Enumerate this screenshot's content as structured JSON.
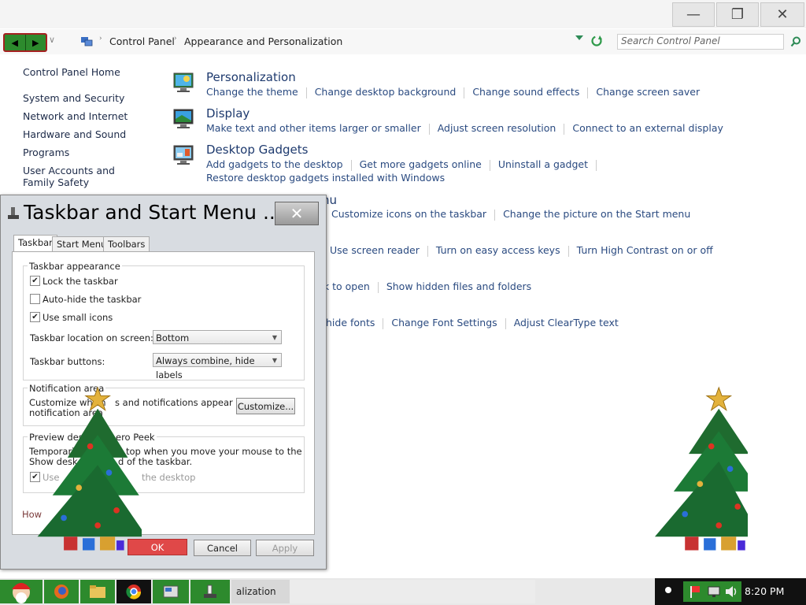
{
  "window": {
    "minimize_glyph": "—",
    "restore_glyph": "❐",
    "close_glyph": "✕"
  },
  "address": {
    "back_glyph": "◀",
    "forward_glyph": "▶",
    "dropdown_glyph": "∨",
    "breadcrumb": [
      "Control Panel",
      "Appearance and Personalization"
    ],
    "search_placeholder": "Search Control Panel"
  },
  "sidebar": {
    "items": [
      {
        "label": "Control Panel Home"
      },
      {
        "label": "System and Security"
      },
      {
        "label": "Network and Internet"
      },
      {
        "label": "Hardware and Sound"
      },
      {
        "label": "Programs"
      },
      {
        "label": "User Accounts and Family Safety"
      }
    ]
  },
  "categories": [
    {
      "title": "Personalization",
      "links": [
        "Change the theme",
        "Change desktop background",
        "Change sound effects",
        "Change screen saver"
      ]
    },
    {
      "title": "Display",
      "links": [
        "Make text and other items larger or smaller",
        "Adjust screen resolution",
        "Connect to an external display"
      ]
    },
    {
      "title": "Desktop Gadgets",
      "links": [
        "Add gadgets to the desktop",
        "Get more gadgets online",
        "Uninstall a gadget"
      ],
      "links2": [
        "Restore desktop gadgets installed with Windows"
      ]
    }
  ],
  "partial": {
    "taskbar_title_tail": "nu",
    "taskbar_links": [
      "Customize icons on the taskbar",
      "Change the picture on the Start menu"
    ],
    "ease_links": [
      "Use screen reader",
      "Turn on easy access keys",
      "Turn High Contrast on or off"
    ],
    "folder_links": [
      "ck to open",
      "Show hidden files and folders"
    ],
    "font_links": [
      "hide fonts",
      "Change Font Settings",
      "Adjust ClearType text"
    ]
  },
  "dialog": {
    "title": "Taskbar and Start Menu ...",
    "close_glyph": "✕",
    "tabs": [
      "Taskbar",
      "Start Menu",
      "Toolbars"
    ],
    "appearance": {
      "group_label": "Taskbar appearance",
      "lock": "Lock the taskbar",
      "autohide": "Auto-hide the taskbar",
      "small_icons": "Use small icons",
      "location_label": "Taskbar location on screen:",
      "location_value": "Bottom",
      "buttons_label": "Taskbar buttons:",
      "buttons_value": "Always combine, hide labels"
    },
    "notification": {
      "group_label": "Notification area",
      "text_a": "Customize which",
      "text_b": "s and notifications appear in the",
      "text_c": "notification area",
      "customize_button": "Customize..."
    },
    "peek": {
      "group_label_a": "Preview desk",
      "group_label_b": "ero Peek",
      "text_a": "Temporarily",
      "text_b": "top when you move your mouse to the",
      "text_c": "Show desk",
      "text_d": "d of the taskbar.",
      "check_a": "Use",
      "check_b": "the desktop"
    },
    "help_link": "How",
    "ok_button": "OK",
    "cancel_button": "Cancel",
    "apply_button": "Apply"
  },
  "taskbar": {
    "active_label": "alization",
    "clock": "8:20 PM"
  },
  "colors": {
    "accent_link": "#2a4a80",
    "tree_green": "#1f6b2f",
    "star_gold": "#e3b23c"
  }
}
